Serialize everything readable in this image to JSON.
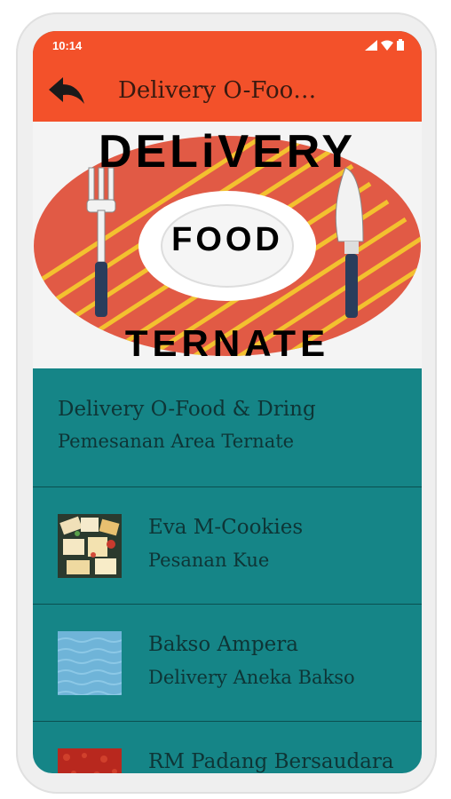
{
  "status_bar": {
    "time": "10:14"
  },
  "app_bar": {
    "title": "Delivery O-Foo…"
  },
  "banner": {
    "top": "DELiVERY",
    "middle": "FOOD",
    "bottom": "TERNATE"
  },
  "list": {
    "header": {
      "title": "Delivery O-Food & Dring",
      "subtitle": "Pemesanan Area Ternate"
    },
    "items": [
      {
        "title": "Eva M-Cookies",
        "subtitle": "Pesanan Kue"
      },
      {
        "title": "Bakso Ampera",
        "subtitle": "Delivery Aneka Bakso"
      },
      {
        "title": "RM Padang Bersaudara",
        "subtitle": ""
      }
    ]
  },
  "colors": {
    "accent": "#f3512a",
    "list_background": "#158587"
  }
}
